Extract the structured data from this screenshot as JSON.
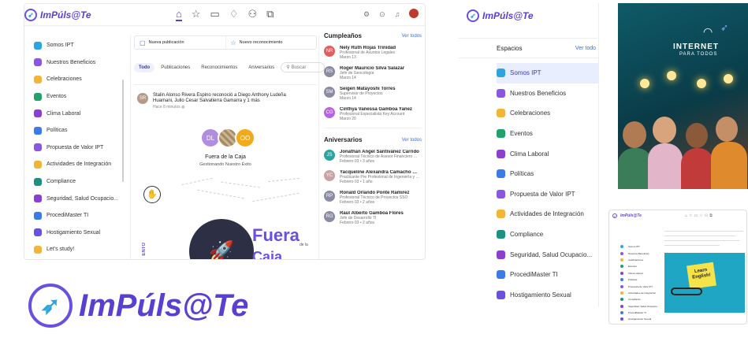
{
  "brand": {
    "name": "ImPúls@Te",
    "accent": "#5b3fd1",
    "accent2": "#2aa5e0"
  },
  "screen1": {
    "nav_icons": [
      "home-icon",
      "star-icon",
      "calendar-icon",
      "tag-icon",
      "users-icon",
      "chat-icon"
    ],
    "right_icons": [
      "settings-icon",
      "help-icon",
      "bell-icon"
    ],
    "sidebar": [
      {
        "label": "Somos IPT",
        "color": "#2aa5e0"
      },
      {
        "label": "Nuestros Beneficios",
        "color": "#8a58e0"
      },
      {
        "label": "Celebraciones",
        "color": "#f2b53a"
      },
      {
        "label": "Eventos",
        "color": "#23a16b"
      },
      {
        "label": "Clima Laboral",
        "color": "#8b3fd1"
      },
      {
        "label": "Políticas",
        "color": "#3b7be8"
      },
      {
        "label": "Propuesta de Valor IPT",
        "color": "#8a58e0"
      },
      {
        "label": "Actividades de Integración",
        "color": "#f2b53a"
      },
      {
        "label": "Compliance",
        "color": "#1e8f83"
      },
      {
        "label": "Seguridad, Salud Ocupacio...",
        "color": "#8b3fd1"
      },
      {
        "label": "ProcediMaster TI",
        "color": "#3b7be8"
      },
      {
        "label": "Hostigamiento Sexual",
        "color": "#6a4fe0"
      },
      {
        "label": "Let's study!",
        "color": "#f2b53a"
      }
    ],
    "composer": {
      "new_post": "Nueva publicación",
      "new_recognition": "Nuevo reconocimiento"
    },
    "tabs": [
      "Todo",
      "Publicaciones",
      "Reconocimientos",
      "Aniversarios"
    ],
    "search_placeholder": "Buscar",
    "post": {
      "author_initials": "SR",
      "text": "Stalin Alonso Rivera Espino reconoció a Diego Anthony Ludeña Huamani, Julio Cesar Salvatierra Gamarra y 1 más",
      "time": "Hace 8 minutos",
      "badge1": "DL",
      "badge3": "OO",
      "title": "Fuera de la Caja",
      "subtitle": "Gestionando Nuestro Éxito",
      "banner_big": "Fuera",
      "banner_small": "de la",
      "banner_cut": "Caja",
      "side_text": "ENTO"
    },
    "birthdays": {
      "title": "Cumpleaños",
      "see_all": "Ver todos",
      "people": [
        {
          "ini": "NR",
          "name": "Nely Ruth Rojas Trinidad",
          "role": "Profesional de Asuntos Legales",
          "date": "Marzo 13",
          "color": "#e35d5d"
        },
        {
          "ini": "RS",
          "name": "Roger Mauricio Silva Salazar",
          "role": "Jefe de Geocología",
          "date": "Marzo 14",
          "color": "#8a8ca3"
        },
        {
          "ini": "SM",
          "name": "Seigen Matayoshi Torres",
          "role": "Supervisor de Proyectos",
          "date": "Marzo 14",
          "color": "#8a8ca3"
        },
        {
          "ini": "CG",
          "name": "Cinthya Vanessa Gamboa Yañez",
          "role": "Profesional Especialista Key Account",
          "date": "Marzo 20",
          "color": "#b864e0"
        }
      ]
    },
    "anniversaries": {
      "title": "Aniversarios",
      "see_all": "Ver todos",
      "people": [
        {
          "ini": "JS",
          "name": "Jonathan Angel Santiváñez Carrido",
          "role": "Profesional Técnico de Asesor Financiero Co...",
          "date": "Febrero 03 • 3 años",
          "color": "#2aa5a0"
        },
        {
          "ini": "YC",
          "name": "Yacqueline Alexandra Camacho Vil...",
          "role": "Practicante Pre Profesional de Ingeniería y P...",
          "date": "Febrero 03 • 1 año",
          "color": "#c9a3a3"
        },
        {
          "ini": "RP",
          "name": "Ronald Orlando Ponte Ramirez",
          "role": "Profesional Técnico de Proyectos SSO",
          "date": "Febrero 03 • 2 años",
          "color": "#8a8ca3"
        },
        {
          "ini": "RG",
          "name": "Raul Alberto Gamboa Flores",
          "role": "Jefe de Desarrollo TI",
          "date": "Febrero 03 • 2 años",
          "color": "#8a8ca3"
        }
      ]
    }
  },
  "screen2": {
    "header": "Espacios",
    "see_all": "Ver todo",
    "items": [
      {
        "label": "Somos IPT",
        "color": "#2aa5e0"
      },
      {
        "label": "Nuestros Beneficios",
        "color": "#8a58e0"
      },
      {
        "label": "Celebraciones",
        "color": "#f2b53a"
      },
      {
        "label": "Eventos",
        "color": "#23a16b"
      },
      {
        "label": "Clima Laboral",
        "color": "#8b3fd1"
      },
      {
        "label": "Políticas",
        "color": "#3b7be8"
      },
      {
        "label": "Propuesta de Valor IPT",
        "color": "#8a58e0"
      },
      {
        "label": "Actividades de Integración",
        "color": "#f2b53a"
      },
      {
        "label": "Compliance",
        "color": "#1e8f83"
      },
      {
        "label": "Seguridad, Salud Ocupacio...",
        "color": "#8b3fd1"
      },
      {
        "label": "ProcediMaster TI",
        "color": "#3b7be8"
      },
      {
        "label": "Hostigamiento Sexual",
        "color": "#6a4fe0"
      }
    ]
  },
  "poster": {
    "line1": "INTERNET",
    "line2": "PARA TODOS"
  },
  "thumb": {
    "sticky": "Learn English!"
  }
}
